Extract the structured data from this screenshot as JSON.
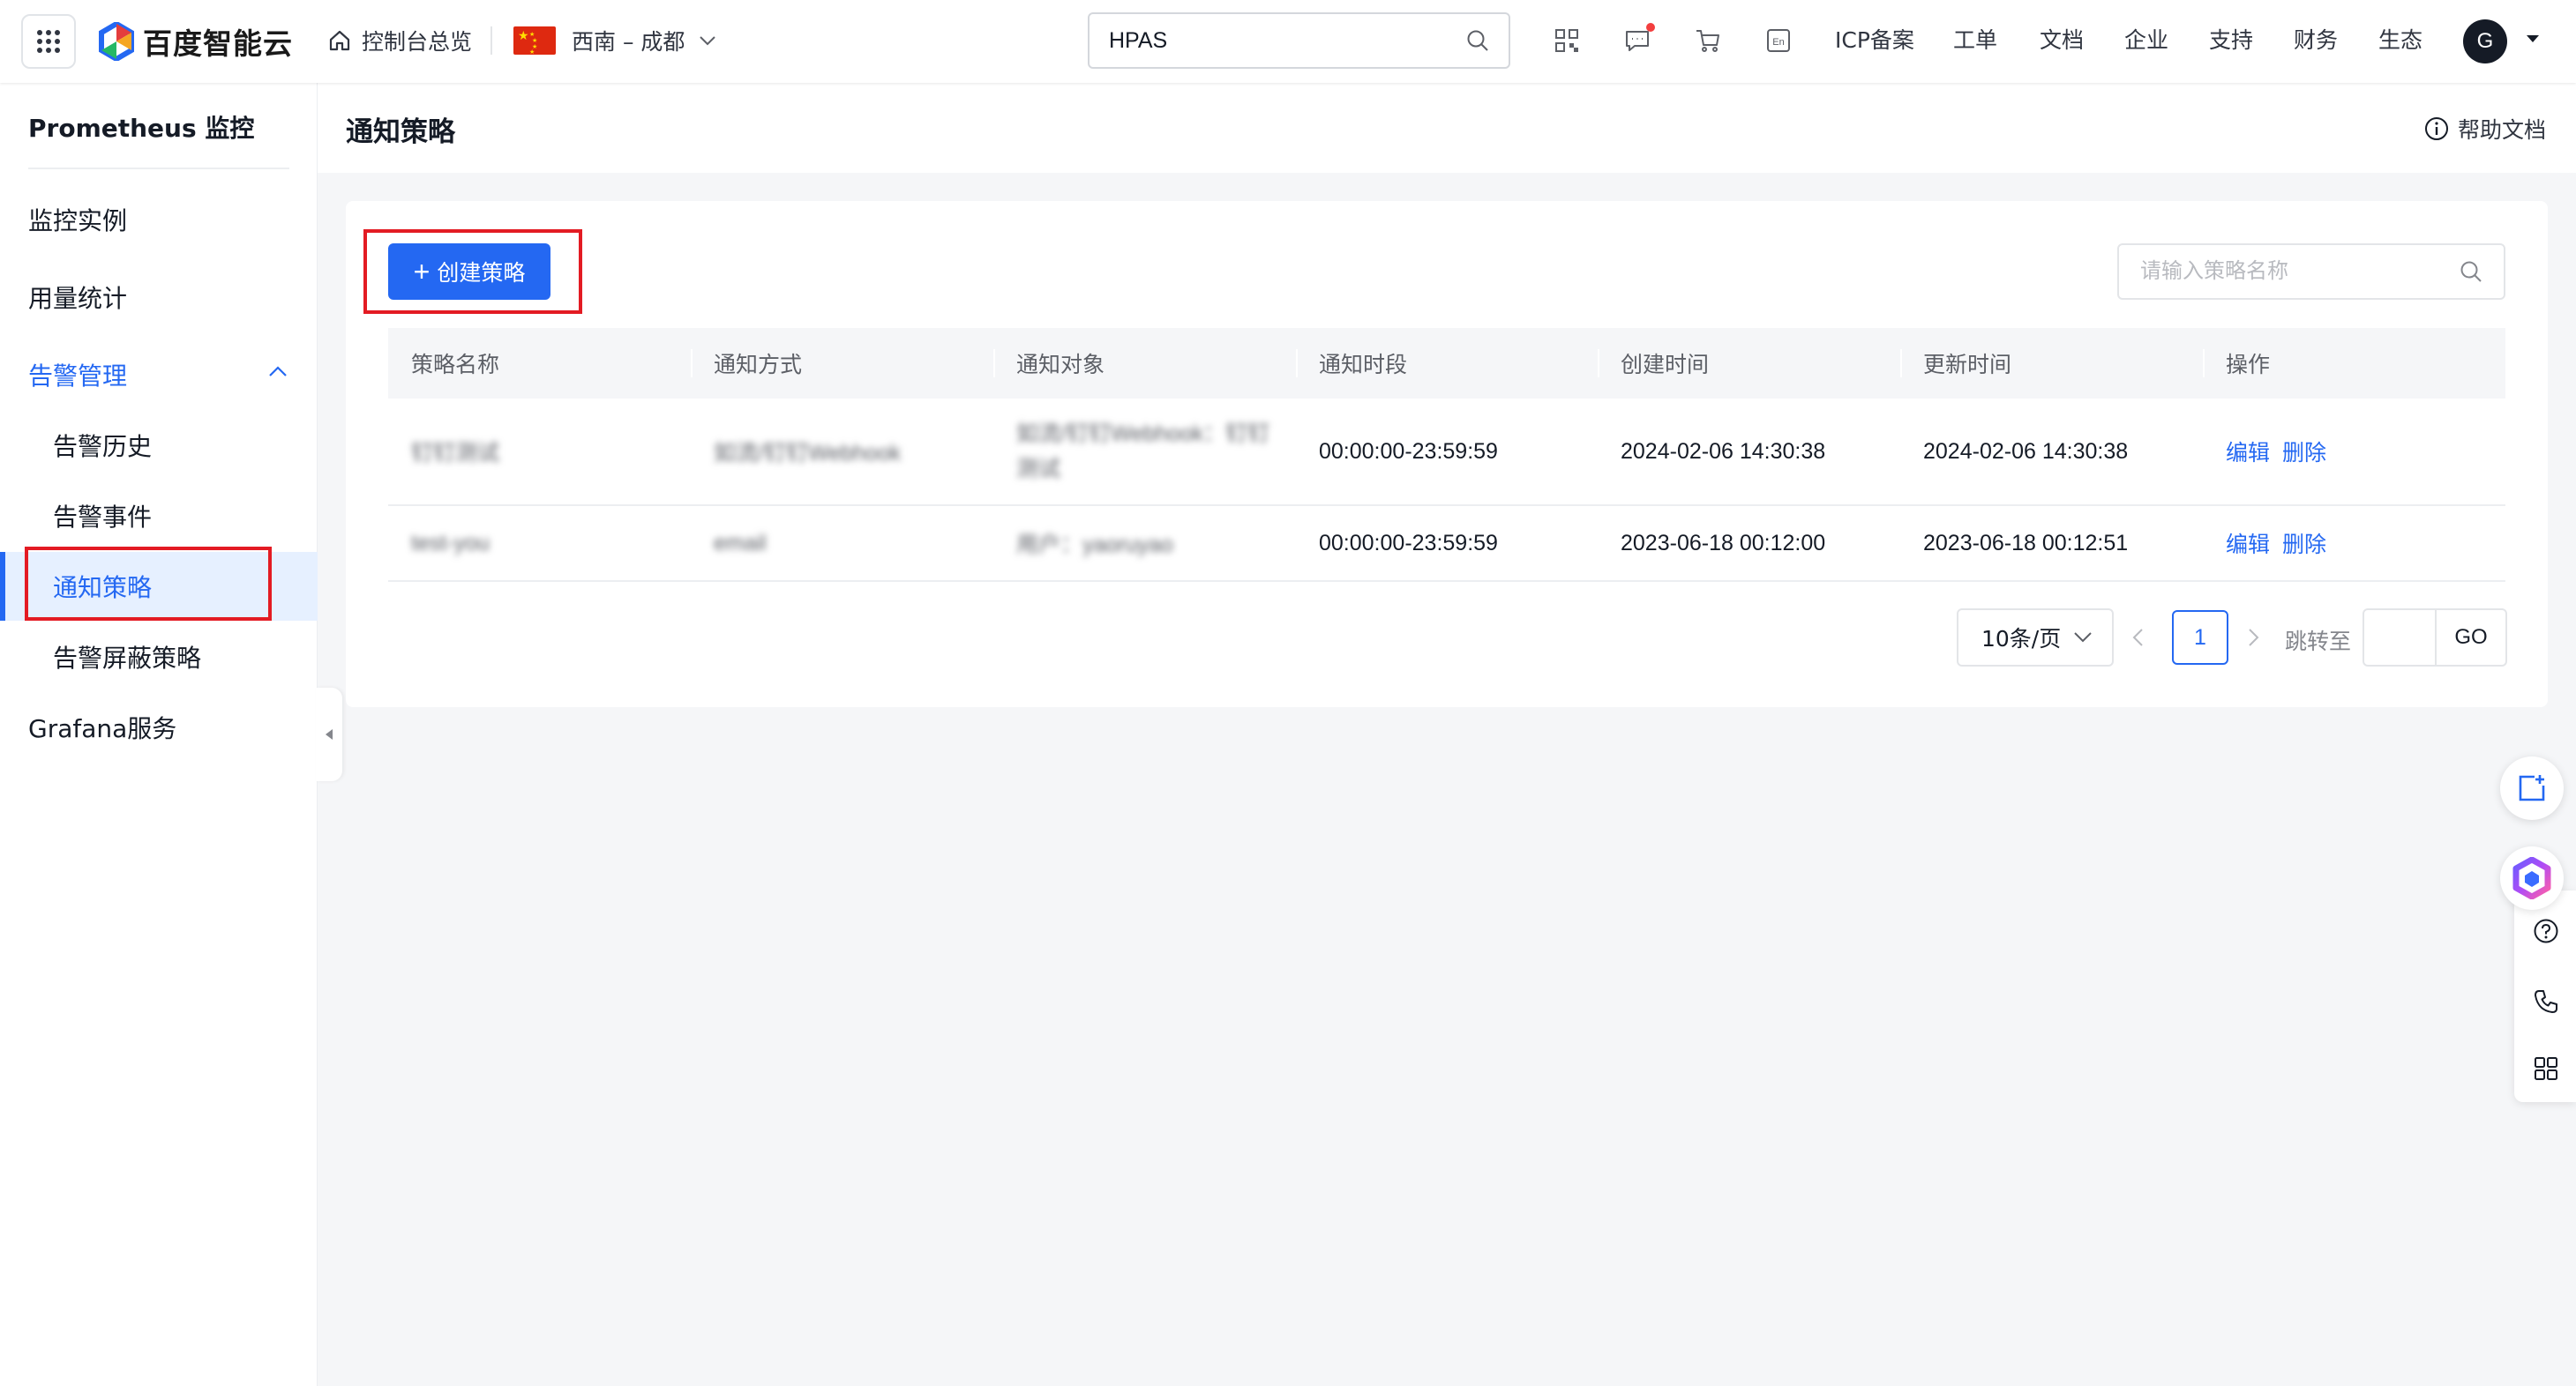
{
  "topbar": {
    "logo_text": "百度智能云",
    "home_label": "控制台总览",
    "region_label": "西南 – 成都",
    "search_value": "HPAS",
    "links": [
      "ICP备案",
      "工单",
      "文档",
      "企业",
      "支持",
      "财务",
      "生态"
    ],
    "lang_icon_text": "En",
    "avatar_letter": "G"
  },
  "sidebar": {
    "title": "Prometheus 监控",
    "items": [
      {
        "label": "监控实例"
      },
      {
        "label": "用量统计"
      },
      {
        "label": "告警管理"
      },
      {
        "label": "告警历史"
      },
      {
        "label": "告警事件"
      },
      {
        "label": "通知策略"
      },
      {
        "label": "告警屏蔽策略"
      },
      {
        "label": "Grafana服务"
      }
    ]
  },
  "page": {
    "title": "通知策略",
    "help_label": "帮助文档",
    "create_button": "创建策略",
    "search_placeholder": "请输入策略名称"
  },
  "table": {
    "headers": [
      "策略名称",
      "通知方式",
      "通知对象",
      "通知时段",
      "创建时间",
      "更新时间",
      "操作"
    ],
    "rows": [
      {
        "name": "钉钉测试",
        "method": "如流/钉钉Webhook",
        "target": "如流/钉钉Webhook：钉钉测试",
        "period": "00:00:00-23:59:59",
        "created": "2024-02-06 14:30:38",
        "updated": "2024-02-06 14:30:38",
        "edit": "编辑",
        "delete": "删除"
      },
      {
        "name": "test-you",
        "method": "email",
        "target": "用户：yaoruyao",
        "period": "00:00:00-23:59:59",
        "created": "2023-06-18 00:12:00",
        "updated": "2023-06-18 00:12:51",
        "edit": "编辑",
        "delete": "删除"
      }
    ]
  },
  "pagination": {
    "page_size": "10条/页",
    "current_page": "1",
    "jump_label": "跳转至",
    "go_label": "GO"
  },
  "colors": {
    "primary": "#2468f2",
    "annotation": "#e31b23",
    "notification_dot": "#f33e3e"
  }
}
